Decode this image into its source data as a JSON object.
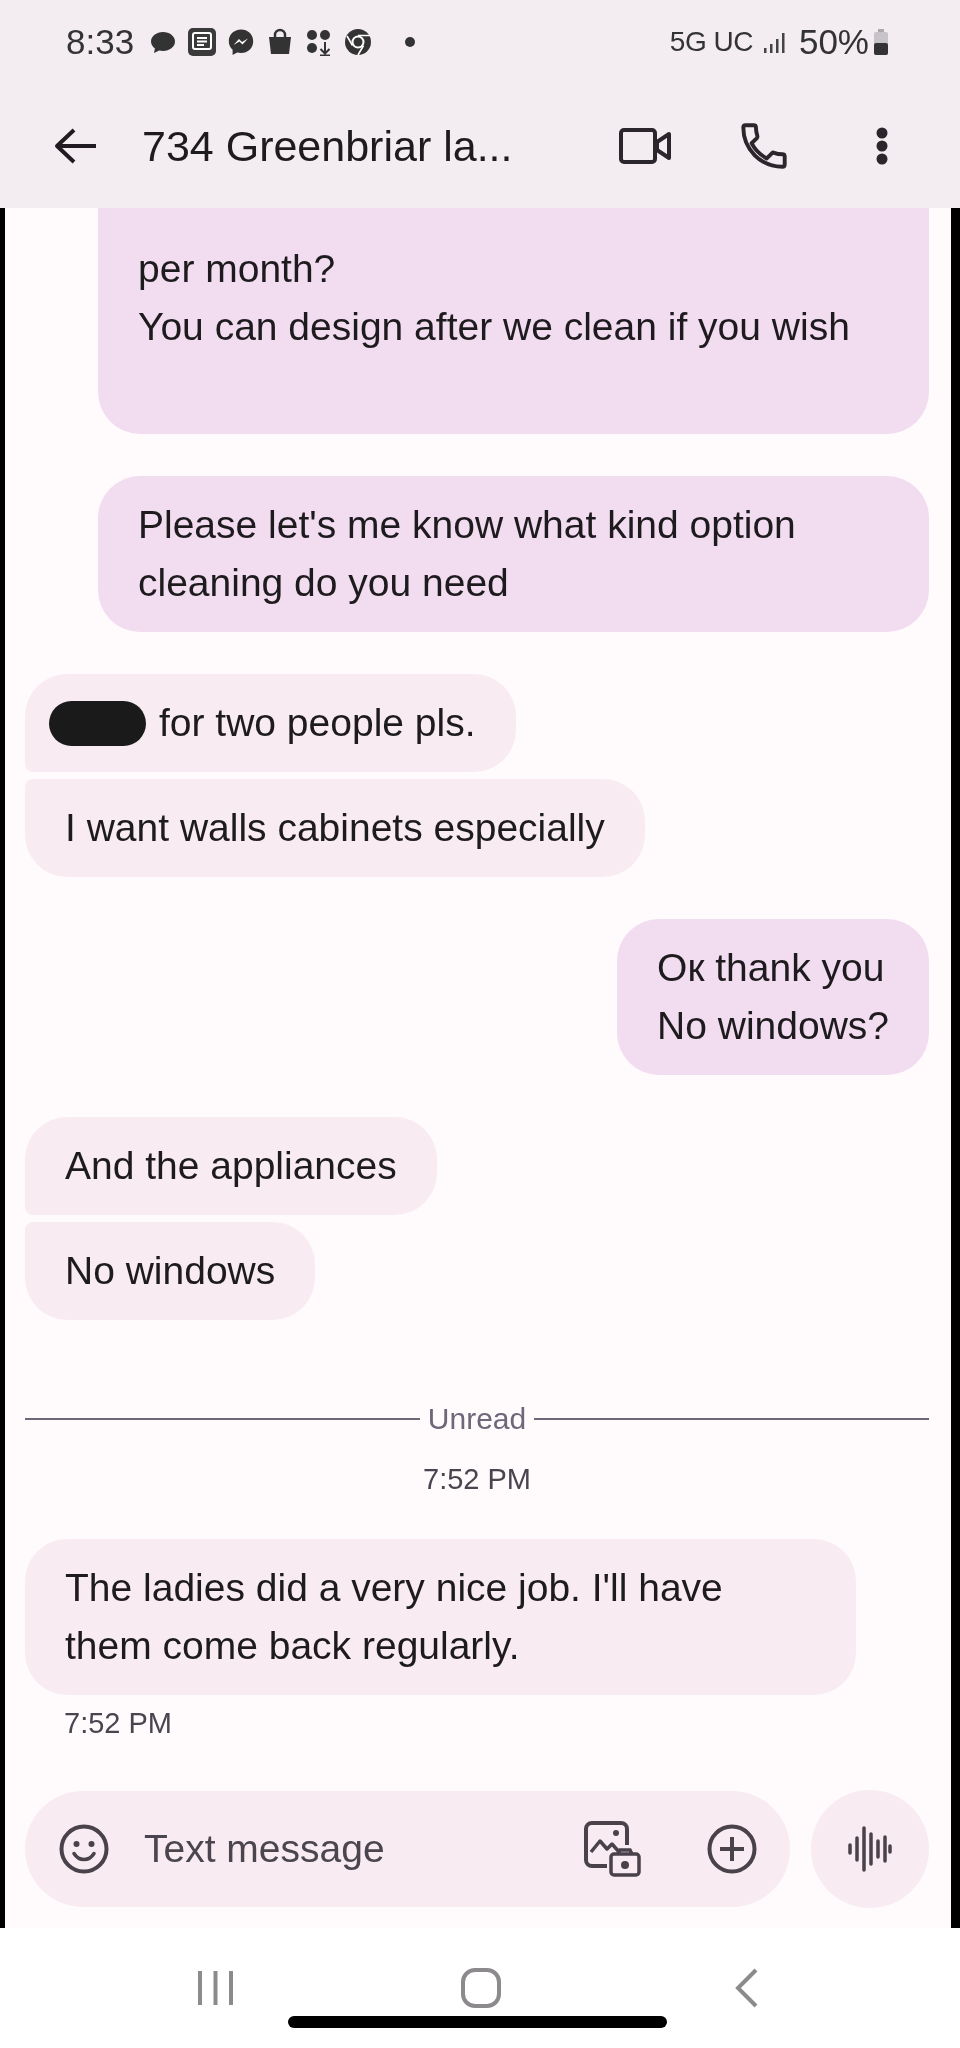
{
  "status_bar": {
    "time": "8:33",
    "network": "5G UC",
    "battery": "50%"
  },
  "header": {
    "title": "734 Greenbriar la..."
  },
  "messages": [
    {
      "kind": "outgoing",
      "text": "per month?\nYou can design after we clean if you wish",
      "cut_top": true,
      "redacted": false,
      "grouped_with_previous": false
    },
    {
      "kind": "outgoing",
      "text": "Please let's me know what kind option cleaning do you need",
      "cut_top": false,
      "redacted": false,
      "grouped_with_previous": false
    },
    {
      "kind": "incoming",
      "text": "for two people pls.",
      "cut_top": false,
      "redacted": true,
      "grouped_with_previous": false
    },
    {
      "kind": "incoming",
      "text": "I want walls cabinets especially",
      "cut_top": false,
      "redacted": false,
      "grouped_with_previous": true
    },
    {
      "kind": "outgoing",
      "text": "Oк thank you\nNo windows?",
      "cut_top": false,
      "redacted": false,
      "grouped_with_previous": false
    },
    {
      "kind": "incoming",
      "text": "And the appliances",
      "cut_top": false,
      "redacted": false,
      "grouped_with_previous": false
    },
    {
      "kind": "incoming",
      "text": "No windows",
      "cut_top": false,
      "redacted": false,
      "grouped_with_previous": true
    },
    {
      "kind": "divider",
      "label": "Unread"
    },
    {
      "kind": "timestamp",
      "text": "7:52 PM"
    },
    {
      "kind": "incoming",
      "text": "The ladies did a very nice job. I'll have them come back regularly.",
      "cut_top": false,
      "redacted": false,
      "grouped_with_previous": false
    },
    {
      "kind": "message_time",
      "text": "7:52 PM"
    }
  ],
  "composer": {
    "placeholder": "Text message"
  }
}
